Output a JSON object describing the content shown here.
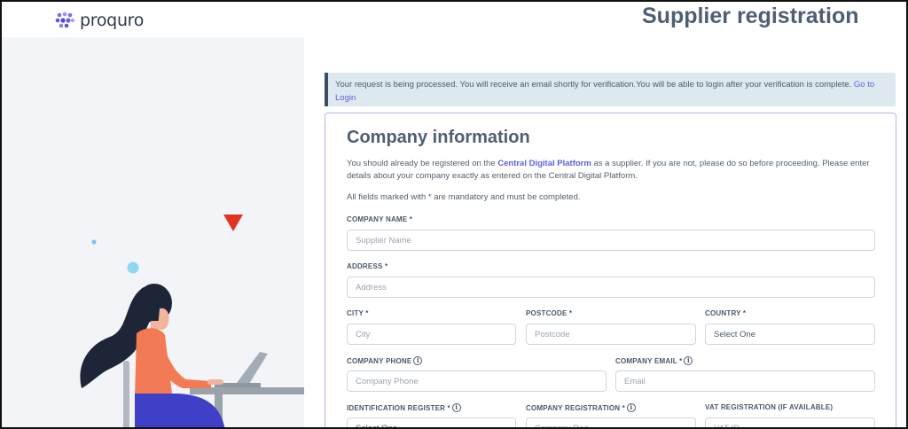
{
  "header": {
    "brand": "proquro",
    "title": "Supplier registration"
  },
  "notice": {
    "message": "Your request is being processed. You will receive an email shortly for verification.You will be able to login after your verification is complete. ",
    "link_text": "Go to Login"
  },
  "form": {
    "title": "Company information",
    "intro_before": "You should already be registered on the ",
    "intro_link": "Central Digital Platform",
    "intro_after": " as a supplier. If you are not, please do so before proceeding. Please enter details about your company exactly as entered on the Central Digital Platform.",
    "mandatory_note": "All fields marked with * are mandatory and must be completed.",
    "company_name": {
      "label": "COMPANY NAME *",
      "placeholder": "Supplier Name"
    },
    "address": {
      "label": "ADDRESS *",
      "placeholder": "Address"
    },
    "city": {
      "label": "CITY *",
      "placeholder": "City"
    },
    "postcode": {
      "label": "POSTCODE *",
      "placeholder": "Postcode"
    },
    "country": {
      "label": "COUNTRY *",
      "value": "Select One"
    },
    "company_phone": {
      "label": "COMPANY PHONE",
      "placeholder": "Company Phone"
    },
    "company_email": {
      "label": "COMPANY EMAIL *",
      "placeholder": "Email"
    },
    "identification_register": {
      "label": "IDENTIFICATION REGISTER *",
      "value": "Select One"
    },
    "company_registration": {
      "label": "COMPANY REGISTRATION *",
      "placeholder": "Company Reg"
    },
    "vat_registration": {
      "label": "VAT REGISTRATION (IF AVAILABLE)",
      "placeholder": "VAT ID"
    },
    "info_glyph": "i"
  },
  "colors": {
    "accent": "#5b5ee6",
    "title": "#4f5f73",
    "notice_bg": "#dde9ee",
    "card_border": "#b9b0ee"
  }
}
